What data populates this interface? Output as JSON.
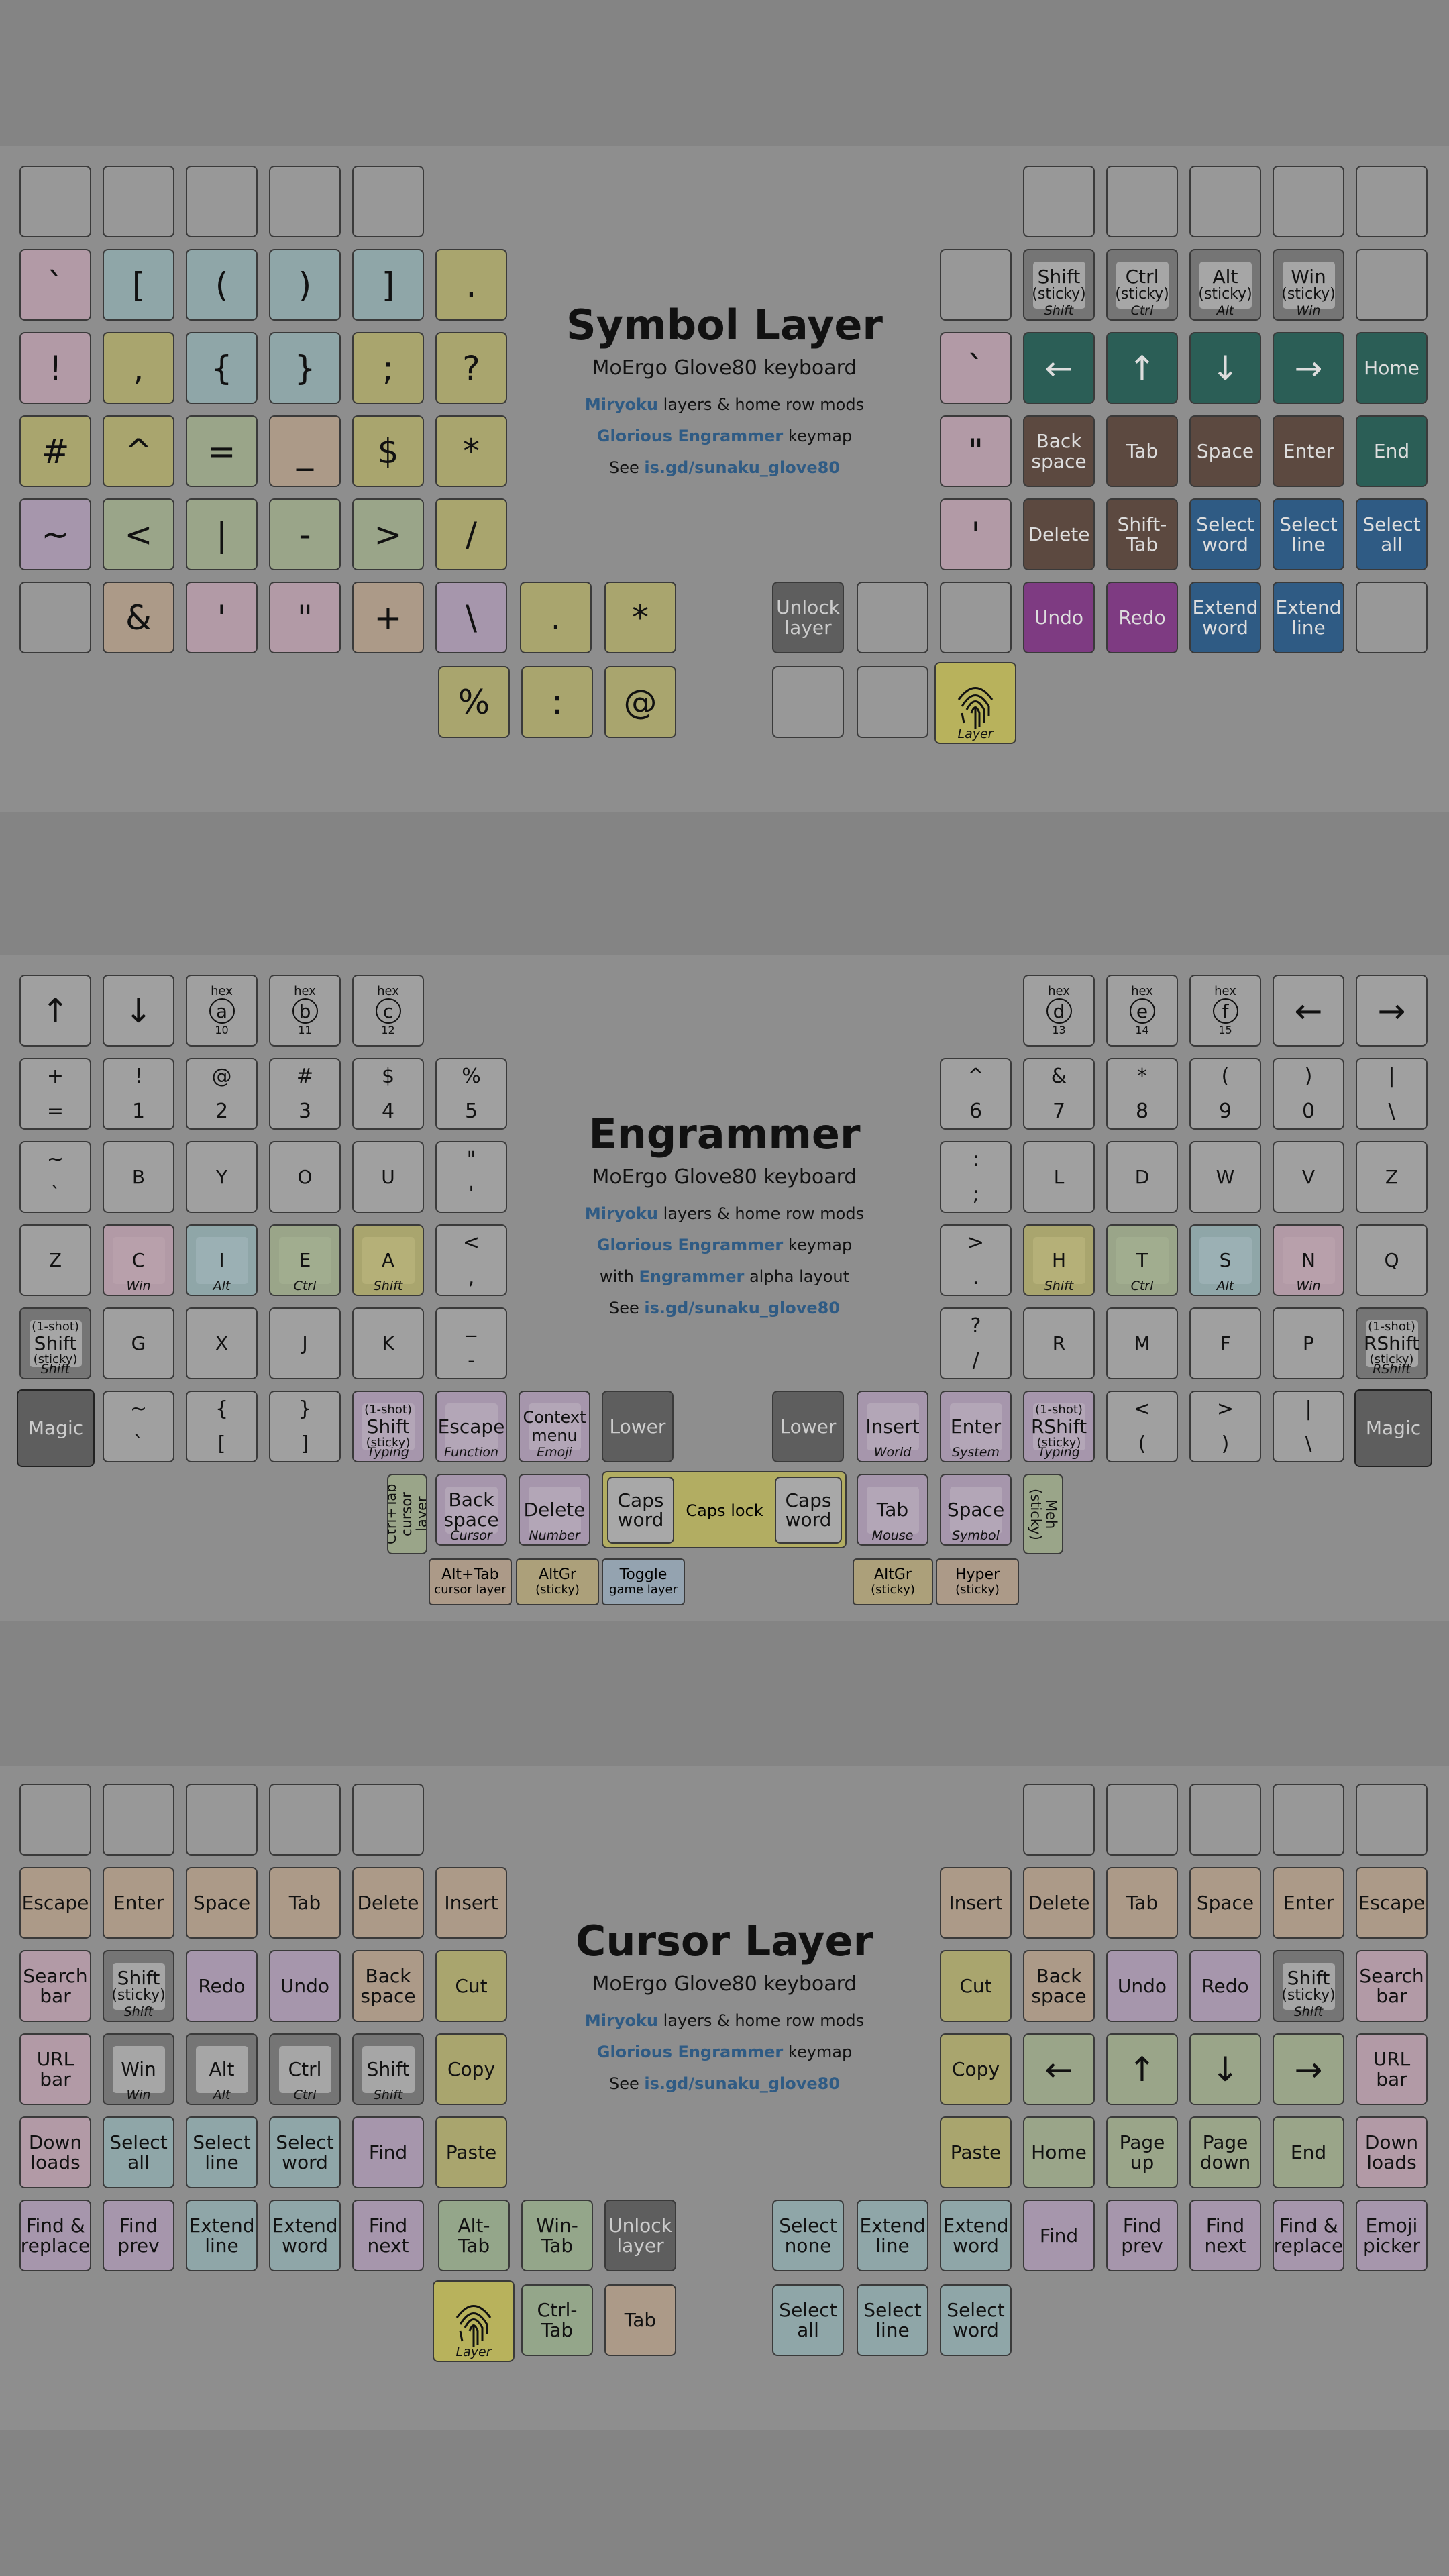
{
  "symbol": {
    "title": "Symbol Layer",
    "subtitle": "MoErgo Glove80 keyboard",
    "desc": {
      "miryoku": "Miryoku",
      "miryoku_rest": " layers & home row mods",
      "engrammer": "Glorious Engrammer",
      "engrammer_rest": " keymap",
      "see": "See ",
      "link": "is.gd/sunaku_glove80"
    },
    "keys": {
      "grave": "`",
      "lbracket": "[",
      "lparen": "(",
      "rparen": ")",
      "rbracket": "]",
      "dot": ".",
      "excl": "!",
      "comma": ",",
      "lbrace": "{",
      "rbrace": "}",
      "semicolon": ";",
      "question": "?",
      "hash": "#",
      "caret": "^",
      "equals": "=",
      "underscore": "_",
      "dollar": "$",
      "asterisk": "*",
      "tilde": "~",
      "less": "<",
      "pipe": "|",
      "minus": "-",
      "greater": ">",
      "slash": "/",
      "amp": "&",
      "apos": "'",
      "dquote": "\"",
      "plus": "+",
      "backslash": "\\",
      "dot2": ".",
      "star2": "*",
      "percent": "%",
      "colon": ":",
      "at": "@",
      "shift": "Shift",
      "shift_sub": "(sticky)",
      "shift_cap": "Shift",
      "ctrl": "Ctrl",
      "ctrl_sub": "(sticky)",
      "ctrl_cap": "Ctrl",
      "alt": "Alt",
      "alt_sub": "(sticky)",
      "alt_cap": "Alt",
      "win": "Win",
      "win_sub": "(sticky)",
      "win_cap": "Win",
      "rgrave": "`",
      "left": "←",
      "up": "↑",
      "down": "↓",
      "right": "→",
      "home": "Home",
      "rdquote": "\"",
      "backspace": "Back\nspace",
      "tab": "Tab",
      "space": "Space",
      "enter": "Enter",
      "end": "End",
      "rapos": "'",
      "delete": "Delete",
      "shifttab": "Shift-\nTab",
      "selword": "Select\nword",
      "selline": "Select\nline",
      "selall": "Select\nall",
      "unlock": "Unlock\nlayer",
      "undo": "Undo",
      "redo": "Redo",
      "extword": "Extend\nword",
      "extline": "Extend\nline",
      "layer_cap": "Layer"
    }
  },
  "engrammer": {
    "title": "Engrammer",
    "subtitle": "MoErgo Glove80 keyboard",
    "desc": {
      "miryoku": "Miryoku",
      "miryoku_rest": " layers & home row mods",
      "engrammer": "Glorious Engrammer",
      "engrammer_rest": " keymap",
      "with": "with ",
      "alpha": "Engrammer",
      "alpha_rest": " alpha layout",
      "see": "See ",
      "link": "is.gd/sunaku_glove80"
    },
    "keys": {
      "up": "↑",
      "down": "↓",
      "hex": "hex",
      "a": "a",
      "a_n": "10",
      "b": "b",
      "b_n": "11",
      "c": "c",
      "c_n": "12",
      "d": "d",
      "d_n": "13",
      "e": "e",
      "e_n": "14",
      "f": "f",
      "f_n": "15",
      "left": "←",
      "right": "→",
      "n1t": "+",
      "n1b": "=",
      "n2t": "!",
      "n2b": "1",
      "n3t": "@",
      "n3b": "2",
      "n4t": "#",
      "n4b": "3",
      "n5t": "$",
      "n5b": "4",
      "n6t": "%",
      "n6b": "5",
      "n7t": "^",
      "n7b": "6",
      "n8t": "&",
      "n8b": "7",
      "n9t": "*",
      "n9b": "8",
      "n10t": "(",
      "n10b": "9",
      "n11t": ")",
      "n11b": "0",
      "n12t": "|",
      "n12b": "\\",
      "r3_1t": "~",
      "r3_1b": "`",
      "B": "B",
      "Y": "Y",
      "O": "O",
      "U": "U",
      "r3_6t": "\"",
      "r3_6b": "'",
      "r3_7t": ":",
      "r3_7b": ";",
      "L": "L",
      "D": "D",
      "W": "W",
      "V": "V",
      "Z2": "Z",
      "Z": "Z",
      "C": "C",
      "C_cap": "Win",
      "I": "I",
      "I_cap": "Alt",
      "E": "E",
      "E_cap": "Ctrl",
      "A": "A",
      "A_cap": "Shift",
      "r4_6t": "<",
      "r4_6b": ",",
      "r4_7t": ">",
      "r4_7b": ".",
      "H": "H",
      "H_cap": "Shift",
      "T": "T",
      "T_cap": "Ctrl",
      "S": "S",
      "S_cap": "Alt",
      "N": "N",
      "N_cap": "Win",
      "Q": "Q",
      "oneshot": "(1-shot)",
      "shift": "Shift",
      "sticky": "(sticky)",
      "shift_cap": "Shift",
      "G": "G",
      "X": "X",
      "J": "J",
      "K": "K",
      "r5_6t": "_",
      "r5_6b": "-",
      "r5_7t": "?",
      "r5_7b": "/",
      "R": "R",
      "M": "M",
      "F": "F",
      "P": "P",
      "rshift": "RShift",
      "rshift_cap": "RShift",
      "magic": "Magic",
      "r6_2t": "~",
      "r6_2b": "`",
      "r6_3t": "{",
      "r6_3b": "[",
      "r6_4t": "}",
      "r6_4b": "]",
      "typing": "Typing",
      "escape": "Escape",
      "function": "Function",
      "context": "Context\nmenu",
      "emoji": "Emoji",
      "lower": "Lower",
      "insert": "Insert",
      "world": "World",
      "enter": "Enter",
      "system": "System",
      "r6_8t": "<",
      "r6_8b": "(",
      "r6_9t": ">",
      "r6_9b": ")",
      "r6_10t": "|",
      "r6_10b": "\\",
      "ctrltab": "Ctrl+Tab\ncursor layer",
      "backspace": "Back\nspace",
      "cursor": "Cursor",
      "delete": "Delete",
      "number": "Number",
      "capsword": "Caps\nword",
      "capslock": "Caps lock",
      "tab": "Tab",
      "mouse": "Mouse",
      "space": "Space",
      "symbol": "Symbol",
      "meh": "Meh\n(sticky)",
      "alttab": "Alt+Tab",
      "alttab_s": "cursor layer",
      "altgr": "AltGr",
      "altgr_s": "(sticky)",
      "toggle": "Toggle",
      "toggle_s": "game layer",
      "altgr2": "AltGr",
      "altgr2_s": "(sticky)",
      "hyper": "Hyper",
      "hyper_s": "(sticky)"
    }
  },
  "cursor": {
    "title": "Cursor Layer",
    "subtitle": "MoErgo Glove80 keyboard",
    "desc": {
      "miryoku": "Miryoku",
      "miryoku_rest": " layers & home row mods",
      "engrammer": "Glorious Engrammer",
      "engrammer_rest": " keymap",
      "see": "See ",
      "link": "is.gd/sunaku_glove80"
    },
    "keys": {
      "escape": "Escape",
      "enter": "Enter",
      "space": "Space",
      "tab": "Tab",
      "delete": "Delete",
      "insert": "Insert",
      "r_insert": "Insert",
      "r_delete": "Delete",
      "r_tab": "Tab",
      "r_space": "Space",
      "r_enter": "Enter",
      "r_escape": "Escape",
      "searchbar": "Search\nbar",
      "shift": "Shift",
      "sticky": "(sticky)",
      "shift_cap": "Shift",
      "redo": "Redo",
      "undo": "Undo",
      "backspace": "Back\nspace",
      "cut": "Cut",
      "r_cut": "Cut",
      "r_backspace": "Back\nspace",
      "r_undo": "Undo",
      "r_redo": "Redo",
      "r_searchbar": "Search\nbar",
      "urlbar": "URL\nbar",
      "win": "Win",
      "win_cap": "Win",
      "alt": "Alt",
      "alt_cap": "Alt",
      "ctrl": "Ctrl",
      "ctrl_cap": "Ctrl",
      "copy": "Copy",
      "r_copy": "Copy",
      "left": "←",
      "up": "↑",
      "down": "↓",
      "right": "→",
      "r_urlbar": "URL\nbar",
      "downloads": "Down\nloads",
      "selall": "Select\nall",
      "selline": "Select\nline",
      "selword": "Select\nword",
      "find": "Find",
      "paste": "Paste",
      "r_paste": "Paste",
      "home": "Home",
      "pageup": "Page\nup",
      "pagedown": "Page\ndown",
      "end": "End",
      "r_downloads": "Down\nloads",
      "findrep": "Find &\nreplace",
      "findprev": "Find\nprev",
      "extline": "Extend\nline",
      "extword": "Extend\nword",
      "findnext": "Find\nnext",
      "alttab": "Alt-\nTab",
      "wintab": "Win-\nTab",
      "unlock": "Unlock\nlayer",
      "selnone": "Select\nnone",
      "r_extline": "Extend\nline",
      "r_extword": "Extend\nword",
      "r_find": "Find",
      "r_findprev": "Find\nprev",
      "r_findnext": "Find\nnext",
      "r_findrep": "Find &\nreplace",
      "emoji": "Emoji\npicker",
      "layer_cap": "Layer",
      "ctrltab": "Ctrl-\nTab",
      "tab2": "Tab",
      "r_selall": "Select\nall",
      "r_selline": "Select\nline",
      "r_selword": "Select\nword"
    }
  }
}
